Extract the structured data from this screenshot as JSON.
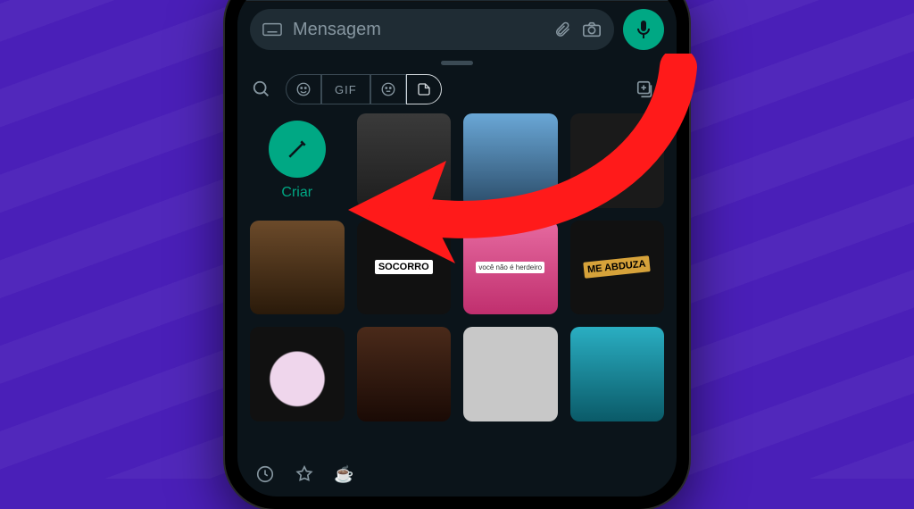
{
  "input": {
    "placeholder": "Mensagem"
  },
  "tabs": {
    "gif_label": "GIF"
  },
  "create": {
    "label": "Criar"
  },
  "stickers": {
    "socorro": "SOCORRO",
    "voce_nao": "você não é herdeiro",
    "abduza": "ME ABDUZA"
  },
  "colors": {
    "accent": "#00a884",
    "pointer": "#ff1a1a"
  },
  "bottom_icons": {
    "cup": "☕"
  }
}
